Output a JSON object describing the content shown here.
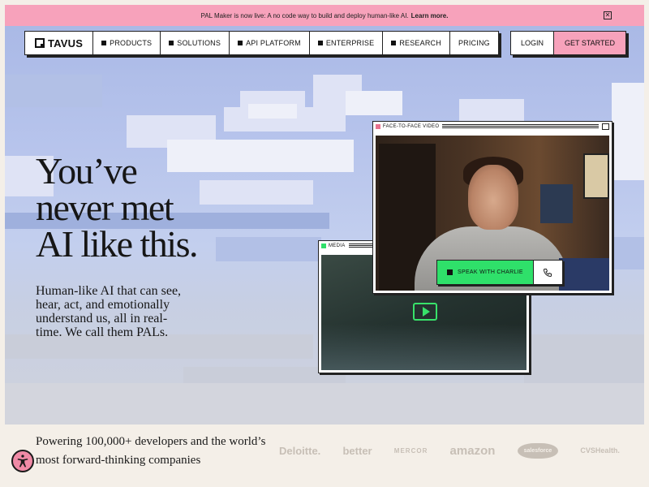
{
  "announcement": {
    "text": "PAL Maker is now live: A no code way to build and deploy human-like AI.",
    "link": "Learn more.",
    "close_glyph": "✕"
  },
  "nav": {
    "brand": "TAVUS",
    "items": [
      "PRODUCTS",
      "SOLUTIONS",
      "API PLATFORM",
      "ENTERPRISE",
      "RESEARCH"
    ],
    "pricing": "PRICING",
    "login": "LOGIN",
    "get_started": "GET STARTED"
  },
  "hero": {
    "headline_lines": [
      "You’ve",
      "never met",
      "AI like this."
    ],
    "subheadline": "Human-like AI that can see, hear, act, and emotionally understand us, all in real-time. We call them PALs."
  },
  "windows": {
    "face_to_face": {
      "title": "FACE-TO-FACE VIDEO",
      "dot_color": "#e8728f"
    },
    "media": {
      "title": "MEDIA",
      "dot_color": "#2fe06a"
    }
  },
  "speak_button": {
    "label": "SPEAK WITH CHARLIE",
    "icon": "phone-icon"
  },
  "footer": {
    "powered_text": "Powering 100,000+ developers and the world’s most forward-thinking companies",
    "logos": [
      "Deloitte.",
      "better",
      "MERCOR",
      "amazon",
      "salesforce",
      "CVSHealth."
    ]
  },
  "colors": {
    "accent_pink": "#f7a2bb",
    "accent_green": "#2fe06a",
    "sky": "#b7c4ec"
  }
}
